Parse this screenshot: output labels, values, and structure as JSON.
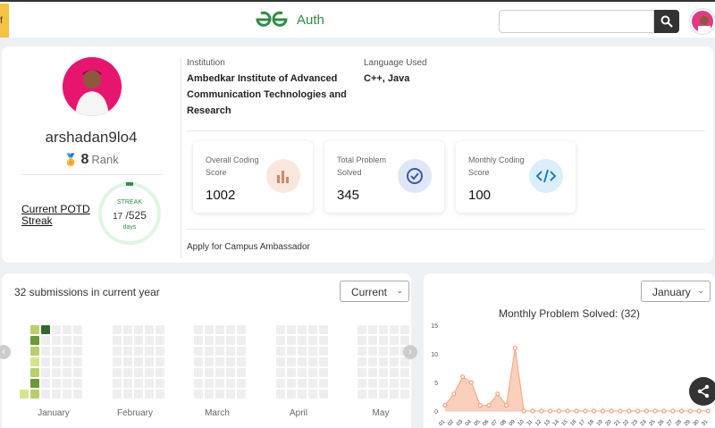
{
  "header": {
    "left_tab": "f",
    "logo_text": "Auth",
    "search_value": ""
  },
  "profile": {
    "username": "arshadan9lo4",
    "rank_value": "8",
    "rank_label": "Rank",
    "potd_label": "Current POTD Streak",
    "streak_label": "STREAK",
    "streak_current": "17",
    "streak_total": "/525",
    "streak_unit": "days",
    "institution_label": "Institution",
    "institution_value": "Ambedkar Institute of Advanced Communication Technologies and Research",
    "language_label": "Language Used",
    "language_value": "C++, Java",
    "ambassador_link": "Apply for Campus Ambassador"
  },
  "stats": [
    {
      "label": "Overall Coding Score",
      "value": "1002",
      "icon": "bar-chart-icon",
      "color": "#f9e6dc"
    },
    {
      "label": "Total Problem Solved",
      "value": "345",
      "icon": "check-badge-icon",
      "color": "#dfe6f7"
    },
    {
      "label": "Monthly Coding Score",
      "value": "100",
      "icon": "code-icon",
      "color": "#dbeefa"
    }
  ],
  "submissions": {
    "title": "32 submissions in current year",
    "year_select": "Current",
    "months": [
      "January",
      "February",
      "March",
      "April",
      "May"
    ]
  },
  "monthly": {
    "month_select": "January",
    "title": "Monthly Problem Solved: (32)"
  },
  "chart_data": {
    "type": "area",
    "title": "Monthly Problem Solved: (32)",
    "x": [
      "01",
      "02",
      "03",
      "04",
      "05",
      "06",
      "07",
      "08",
      "09",
      "10",
      "11",
      "12",
      "13",
      "14",
      "15",
      "16",
      "17",
      "18",
      "19",
      "20",
      "21",
      "22",
      "23",
      "24",
      "25",
      "26",
      "27",
      "28",
      "29",
      "30",
      "31"
    ],
    "values": [
      1,
      3,
      6,
      5,
      1,
      1,
      3,
      1,
      11,
      0,
      0,
      0,
      0,
      0,
      0,
      0,
      0,
      0,
      0,
      0,
      0,
      0,
      0,
      0,
      0,
      0,
      0,
      0,
      0,
      0,
      0
    ],
    "yticks": [
      0,
      5,
      10,
      15
    ],
    "ylim": [
      0,
      15
    ],
    "color": "#f4a27c",
    "fill": "#f9c8b2"
  },
  "colors": {
    "brand": "#2f8d46",
    "accent": "#f5c242",
    "streak": "#2f8d46"
  }
}
